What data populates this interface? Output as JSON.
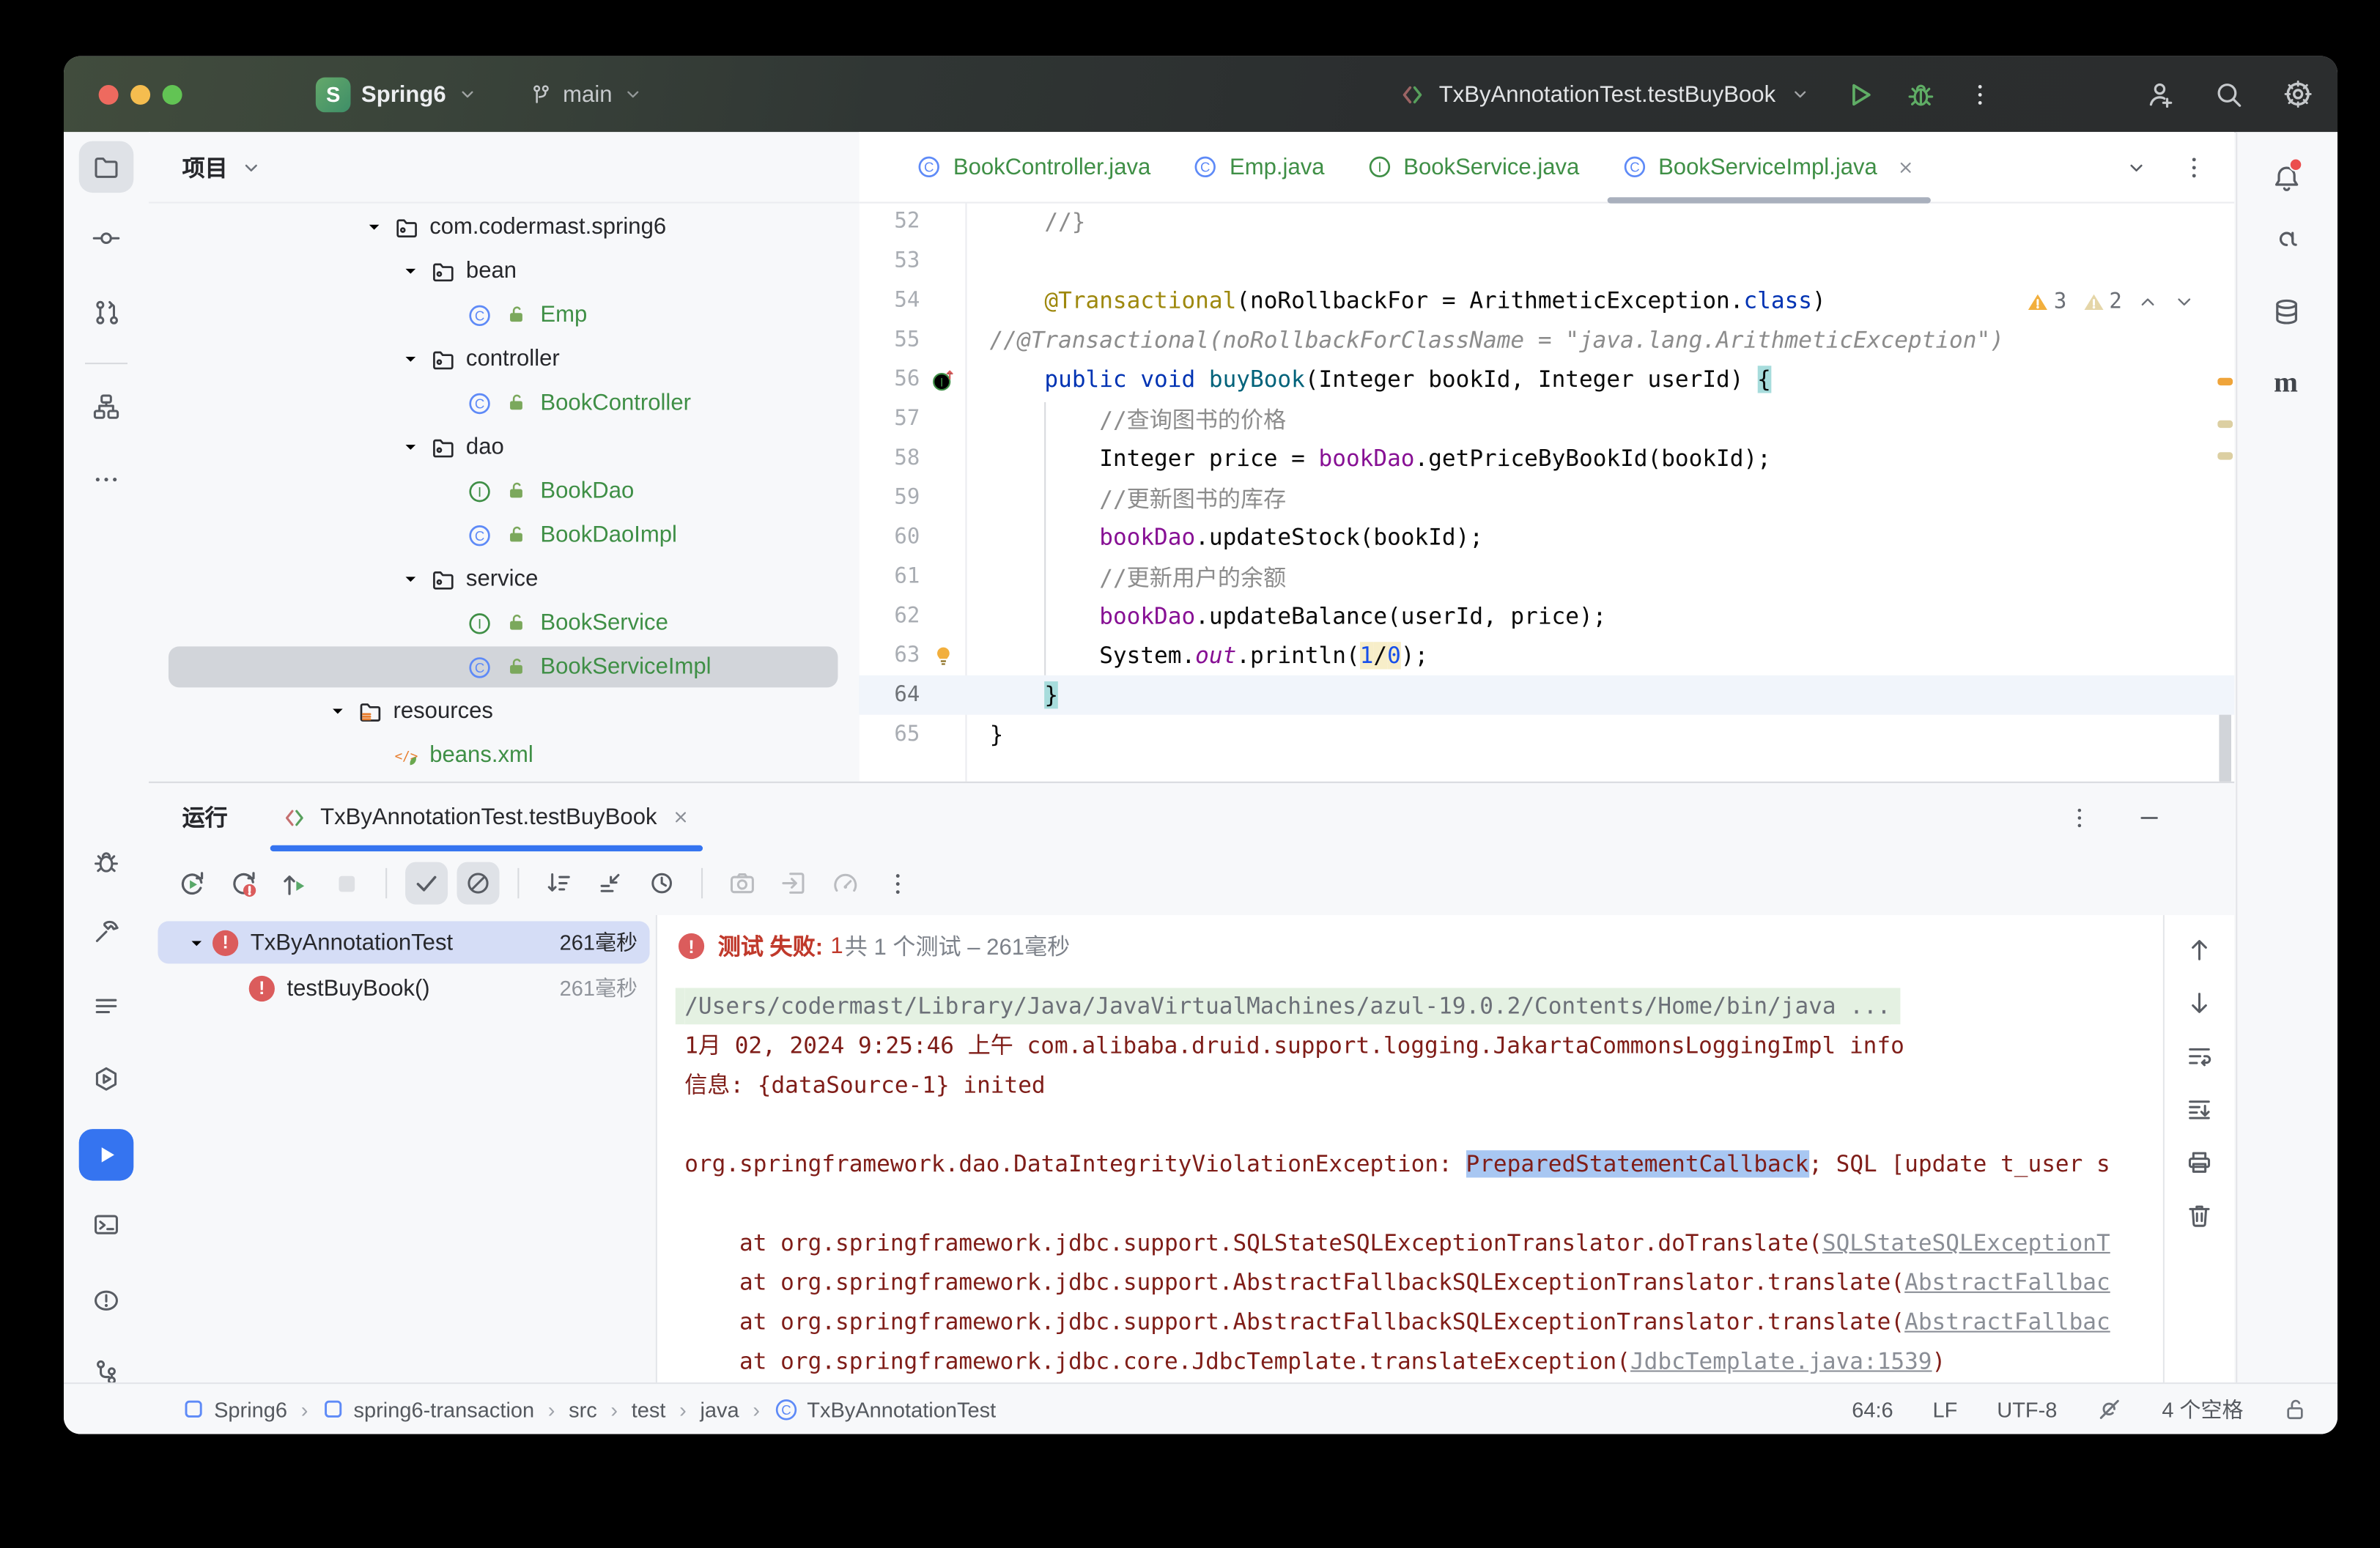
{
  "titlebar": {
    "project_initial": "S",
    "project_name": "Spring6",
    "branch_name": "main",
    "run_config": "TxByAnnotationTest.testBuyBook"
  },
  "left_strip": {
    "top": [
      {
        "icon": "project-folder",
        "active": "gray"
      },
      {
        "icon": "commit"
      },
      {
        "icon": "pull-requests"
      },
      {
        "icon": "structure"
      },
      {
        "icon": "more-dots"
      }
    ],
    "bottom": [
      {
        "icon": "debug-bug"
      },
      {
        "icon": "build-hammer"
      },
      {
        "icon": "todo-lines"
      },
      {
        "icon": "services-hexagon"
      },
      {
        "icon": "run-play",
        "active": "blue"
      },
      {
        "icon": "terminal"
      },
      {
        "icon": "problems"
      },
      {
        "icon": "git-branch"
      }
    ]
  },
  "right_strip": [
    {
      "icon": "notifications-bell",
      "badge": true
    },
    {
      "icon": "ai-assistant"
    },
    {
      "icon": "database"
    },
    {
      "icon": "maven"
    }
  ],
  "project_panel": {
    "title": "项目",
    "tree": [
      {
        "label": "com.codermast.spring6",
        "depth": 1,
        "chevron": true,
        "icon": "package-folder",
        "cls": ""
      },
      {
        "label": "bean",
        "depth": 2,
        "chevron": true,
        "icon": "package-folder",
        "cls": ""
      },
      {
        "label": "Emp",
        "depth": 3,
        "icon": "class-icon",
        "icon2": "lock-mini",
        "cls": "green"
      },
      {
        "label": "controller",
        "depth": 2,
        "chevron": true,
        "icon": "package-folder",
        "cls": ""
      },
      {
        "label": "BookController",
        "depth": 3,
        "icon": "class-icon",
        "icon2": "lock-mini",
        "cls": "green"
      },
      {
        "label": "dao",
        "depth": 2,
        "chevron": true,
        "icon": "package-folder",
        "cls": ""
      },
      {
        "label": "BookDao",
        "depth": 3,
        "icon": "interface-icon",
        "icon2": "lock-mini",
        "cls": "green"
      },
      {
        "label": "BookDaoImpl",
        "depth": 3,
        "icon": "class-icon",
        "icon2": "lock-mini",
        "cls": "green"
      },
      {
        "label": "service",
        "depth": 2,
        "chevron": true,
        "icon": "package-folder",
        "cls": ""
      },
      {
        "label": "BookService",
        "depth": 3,
        "icon": "interface-icon",
        "icon2": "lock-mini",
        "cls": "green"
      },
      {
        "label": "BookServiceImpl",
        "depth": 3,
        "icon": "class-icon",
        "icon2": "lock-mini",
        "cls": "green",
        "selected": true
      },
      {
        "label": "resources",
        "depth": 0,
        "chevron": true,
        "icon": "resources-folder",
        "cls": ""
      },
      {
        "label": "beans.xml",
        "depth": 1,
        "icon": "spring-xml",
        "cls": "green"
      }
    ]
  },
  "editor": {
    "tabs": [
      {
        "label": "BookController.java",
        "icon": "class-icon"
      },
      {
        "label": "Emp.java",
        "icon": "class-icon"
      },
      {
        "label": "BookService.java",
        "icon": "interface-icon"
      },
      {
        "label": "BookServiceImpl.java",
        "icon": "class-icon",
        "active": true
      }
    ],
    "inspections": {
      "warnings": "3",
      "weak_warnings": "2"
    },
    "code_lines": [
      {
        "n": "52",
        "seg": [
          [
            "    //}",
            "cmt"
          ]
        ]
      },
      {
        "n": "53",
        "seg": []
      },
      {
        "n": "54",
        "seg": [
          [
            "    ",
            "pln"
          ],
          [
            "@Transactional",
            "ann"
          ],
          [
            "(noRollbackFor = ArithmeticException.",
            "pln"
          ],
          [
            "class",
            "kw"
          ],
          [
            ")",
            "pln"
          ]
        ]
      },
      {
        "n": "55",
        "seg": [
          [
            "//@Transactional(noRollbackForClassName = \"java.lang.ArithmeticException\")",
            "cmti"
          ]
        ]
      },
      {
        "n": "56",
        "gutter": "override",
        "seg": [
          [
            "    ",
            "pln"
          ],
          [
            "public void ",
            "kw"
          ],
          [
            "buyBook",
            "mth"
          ],
          [
            "(Integer bookId, Integer userId) ",
            "pln"
          ],
          [
            "{",
            "brh"
          ]
        ]
      },
      {
        "n": "57",
        "seg": [
          [
            "        ",
            "pln"
          ],
          [
            "//查询图书的价格",
            "cmt"
          ]
        ]
      },
      {
        "n": "58",
        "seg": [
          [
            "        Integer price = ",
            "pln"
          ],
          [
            "bookDao",
            "fld"
          ],
          [
            ".getPriceByBookId(bookId);",
            "pln"
          ]
        ]
      },
      {
        "n": "59",
        "seg": [
          [
            "        ",
            "pln"
          ],
          [
            "//更新图书的库存",
            "cmt"
          ]
        ]
      },
      {
        "n": "60",
        "seg": [
          [
            "        ",
            "pln"
          ],
          [
            "bookDao",
            "fld"
          ],
          [
            ".updateStock(bookId);",
            "pln"
          ]
        ]
      },
      {
        "n": "61",
        "seg": [
          [
            "        ",
            "pln"
          ],
          [
            "//更新用户的余额",
            "cmt"
          ]
        ]
      },
      {
        "n": "62",
        "seg": [
          [
            "        ",
            "pln"
          ],
          [
            "bookDao",
            "fld"
          ],
          [
            ".updateBalance(userId, price);",
            "pln"
          ]
        ]
      },
      {
        "n": "63",
        "gutter": "bulb",
        "seg": [
          [
            "        System.",
            "pln"
          ],
          [
            "out",
            "fldi"
          ],
          [
            ".println(",
            "pln"
          ],
          [
            "1",
            "numh"
          ],
          [
            "/",
            "plnh"
          ],
          [
            "0",
            "numh"
          ],
          [
            ");",
            "pln"
          ]
        ]
      },
      {
        "n": "64",
        "caret": true,
        "seg": [
          [
            "    ",
            "pln"
          ],
          [
            "}",
            "brh"
          ]
        ]
      },
      {
        "n": "65",
        "seg": [
          [
            "}",
            "pln"
          ]
        ]
      }
    ]
  },
  "run_panel": {
    "title": "运行",
    "tab_label": "TxByAnnotationTest.testBuyBook",
    "toolbar": [
      {
        "icon": "rerun"
      },
      {
        "icon": "rerun-failed"
      },
      {
        "icon": "rerun-auto"
      },
      {
        "icon": "stop",
        "disabled": true
      },
      {
        "sep": true
      },
      {
        "icon": "check-passed",
        "toggled": true
      },
      {
        "icon": "ignore-slash",
        "toggled": true
      },
      {
        "sep": true
      },
      {
        "icon": "sort-alpha"
      },
      {
        "icon": "sort-direction"
      },
      {
        "icon": "sort-time"
      },
      {
        "sep": true
      },
      {
        "icon": "screenshot",
        "disabled": true
      },
      {
        "icon": "import-tests",
        "disabled": true
      },
      {
        "icon": "coverage",
        "disabled": true
      },
      {
        "icon": "kebab"
      }
    ],
    "tests": [
      {
        "name": "TxByAnnotationTest",
        "time": "261毫秒",
        "depth": 0,
        "chevron": true,
        "selected": true
      },
      {
        "name": "testBuyBook()",
        "time": "261毫秒",
        "depth": 1,
        "dim": true
      }
    ],
    "status": {
      "fail_label": "测试 失败:",
      "fail_count": "1",
      "summary": "共 1 个测试 – 261毫秒"
    },
    "console_lines": [
      [
        [
          "/Users/codermast/Library/Java/JavaVirtualMachines/azul-19.0.2/Contents/Home/bin/java ...",
          "cmd"
        ]
      ],
      [
        [
          "1月 02, 2024 9:25:46 上午 com.alibaba.druid.support.logging.JakartaCommonsLoggingImpl info",
          "err"
        ]
      ],
      [
        [
          "信息: {dataSource-1} inited",
          "err"
        ]
      ],
      [],
      [
        [
          "org.springframework.dao.DataIntegrityViolationException: ",
          "err"
        ],
        [
          "PreparedStatementCallback",
          "errsel"
        ],
        [
          "; SQL [update t_user s",
          "err"
        ]
      ],
      [],
      [
        [
          "    at org.springframework.jdbc.support.SQLStateSQLExceptionTranslator.doTranslate(",
          "err"
        ],
        [
          "SQLStateSQLExceptionT",
          "lnk"
        ]
      ],
      [
        [
          "    at org.springframework.jdbc.support.AbstractFallbackSQLExceptionTranslator.translate(",
          "err"
        ],
        [
          "AbstractFallbac",
          "lnk"
        ]
      ],
      [
        [
          "    at org.springframework.jdbc.support.AbstractFallbackSQLExceptionTranslator.translate(",
          "err"
        ],
        [
          "AbstractFallbac",
          "lnk"
        ]
      ],
      [
        [
          "    at org.springframework.jdbc.core.JdbcTemplate.translateException(",
          "err"
        ],
        [
          "JdbcTemplate.java:1539",
          "lnk"
        ],
        [
          ")",
          "err"
        ]
      ]
    ],
    "console_icons": [
      "arrow-up",
      "arrow-down",
      "soft-wrap",
      "scroll-end",
      "printer",
      "trash"
    ]
  },
  "status_bar": {
    "crumbs": [
      {
        "label": "Spring6",
        "icon": "module-square"
      },
      {
        "label": "spring6-transaction",
        "icon": "module-square"
      },
      {
        "label": "src"
      },
      {
        "label": "test"
      },
      {
        "label": "java"
      },
      {
        "label": "TxByAnnotationTest",
        "icon": "class-icon"
      }
    ],
    "caret_position": "64:6",
    "line_separator": "LF",
    "encoding": "UTF-8",
    "indent": "4 个空格"
  },
  "colors": {
    "accent_blue": "#3574f0",
    "test_green": "#3f8f46",
    "error_red": "#7f1d18",
    "warning_strong": "#f2af3d",
    "warning_weak": "#e5d6a8",
    "selection_blue": "#a8c7f2"
  }
}
